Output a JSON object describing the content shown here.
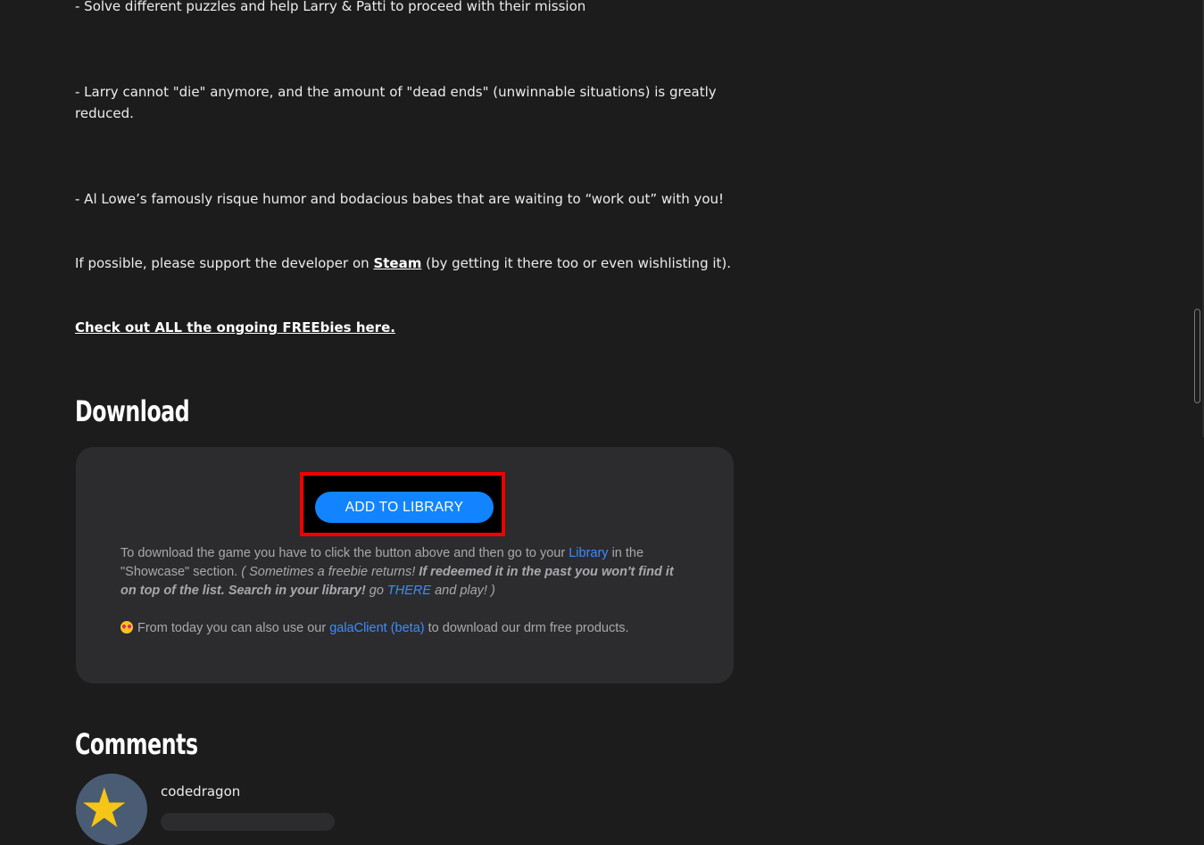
{
  "description": {
    "line_puzzles": "- Solve different puzzles and help Larry & Patti to proceed with their mission",
    "line_die": "- Larry cannot \"die\" anymore, and the amount of \"dead ends\" (unwinnable situations) is greatly reduced.",
    "line_humor": "- Al Lowe’s famously risque humor and bodacious babes that are waiting to “work out” with you!",
    "support_prefix": "If possible, please support the developer on ",
    "support_link": "Steam",
    "support_suffix": " (by getting it there too or even wishlisting it).",
    "freebies_link": "Check out ALL the ongoing FREEbies here."
  },
  "download": {
    "heading": "Download",
    "add_button": "ADD TO LIBRARY",
    "info_part1": "To download the game you have to click the button above and then go to your ",
    "info_library_link": "Library",
    "info_part2": " in the \"Showcase\" section. ",
    "info_italic": "( Sometimes a freebie returns! ",
    "info_bold_italic": "If redeemed it in the past you won't find it on top of the list. Search in your library!",
    "info_go": " go ",
    "info_there_link": "THERE",
    "info_end": " and play! )",
    "client_prefix": "From today you can also use our ",
    "client_link": "galaClient (beta)",
    "client_suffix": " to download our drm free products.",
    "emoji_icon": "heart-eyes-emoji-icon",
    "highlight_color": "#f00000",
    "button_color": "#1384ff"
  },
  "comments": {
    "heading": "Comments",
    "first_user": "codedragon",
    "avatar_icon": "star-avatar-icon"
  }
}
